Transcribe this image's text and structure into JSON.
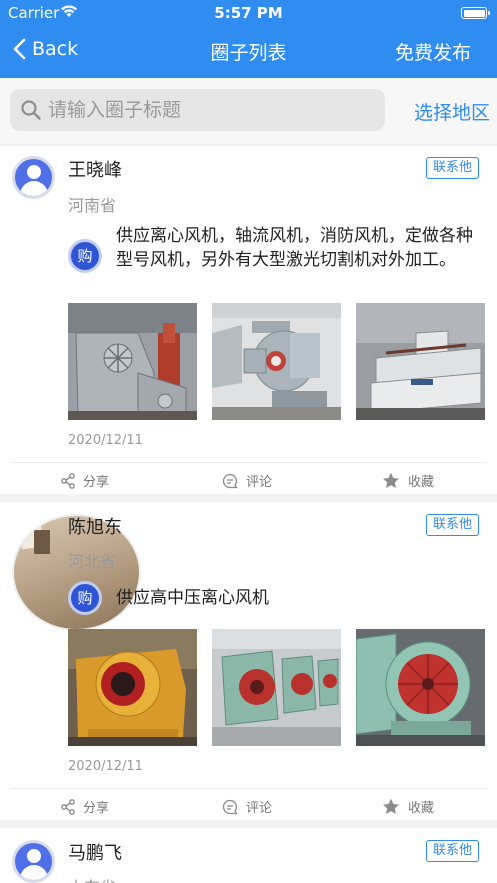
{
  "status_bar": {
    "carrier": "Carrier",
    "time": "5:57 PM"
  },
  "nav": {
    "back_label": "Back",
    "title": "圈子列表",
    "action_label": "免费发布"
  },
  "search": {
    "placeholder": "请输入圈子标题",
    "region_label": "选择地区"
  },
  "posts": [
    {
      "name": "王晓峰",
      "province": "河南省",
      "contact_label": "联系他",
      "badge": "购",
      "text": "供应离心风机，轴流风机，消防风机，定做各种型号风机，另外有大型激光切割机对外加工。",
      "date": "2020/12/11",
      "actions": {
        "share": "分享",
        "comment": "评论",
        "favorite": "收藏"
      }
    },
    {
      "name": "陈旭东",
      "province": "河北省",
      "contact_label": "联系他",
      "badge": "购",
      "text": "供应高中压离心风机",
      "date": "2020/12/11",
      "actions": {
        "share": "分享",
        "comment": "评论",
        "favorite": "收藏"
      }
    },
    {
      "name": "马鹏飞",
      "province": "山东省",
      "contact_label": "联系他"
    }
  ],
  "colors": {
    "primary": "#2f8cf0",
    "badge": "#2f55d4"
  }
}
